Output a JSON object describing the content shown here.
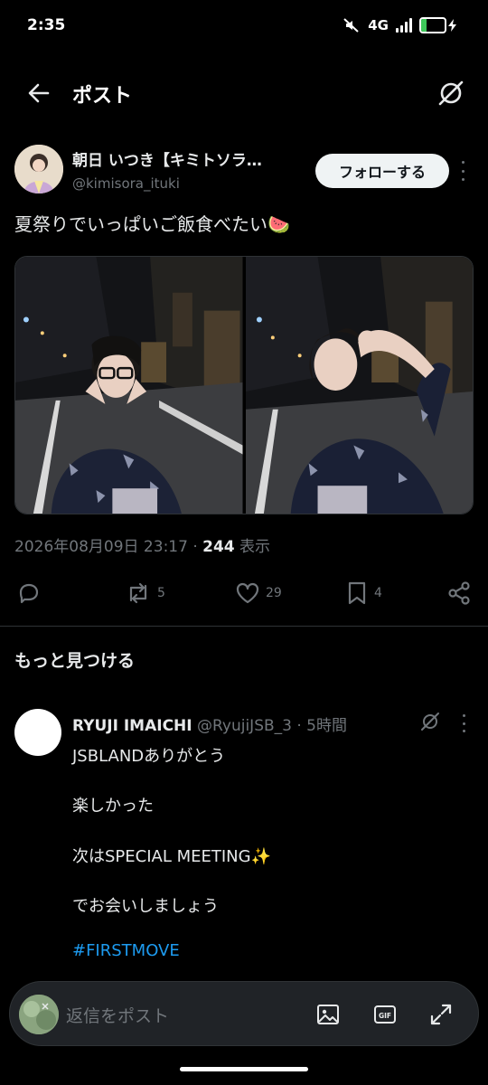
{
  "status_bar": {
    "time": "2:35",
    "network": "4G",
    "battery": "23",
    "battery_level": 0.23,
    "battery_color": "#3ec85a"
  },
  "nav": {
    "title": "ポスト",
    "back_icon": "arrow-left-icon",
    "grok_icon": "grok-icon"
  },
  "post": {
    "author_name": "朝日 いつき【キミトソラ…",
    "author_handle": "@kimisora_ituki",
    "follow_label": "フォローする",
    "text": "夏祭りでいっぱいご飯食べたい🍉",
    "timestamp": "2026年08月09日 23:17 · ",
    "views_count": "244",
    "views_label": " 表示",
    "actions": {
      "reply_count": "",
      "repost_count": "5",
      "like_count": "29",
      "bookmark_count": "4"
    }
  },
  "discover": {
    "heading": "もっと見つける"
  },
  "reply_post": {
    "name": "RYUJI IMAICHI",
    "handle_time": " @RyujiJSB_3 · 5時間",
    "lines": [
      "JSBLANDありがとう",
      "楽しかった",
      "次はSPECIAL MEETING✨",
      "でお会いしましょう"
    ],
    "hashtag": "#FIRSTMOVE"
  },
  "compose": {
    "placeholder": "返信をポスト"
  },
  "colors": {
    "background": "#000000",
    "text_primary": "#e7e9ea",
    "text_secondary": "#71767b",
    "accent_blue": "#1d9bf0",
    "divider": "#2f3336"
  }
}
